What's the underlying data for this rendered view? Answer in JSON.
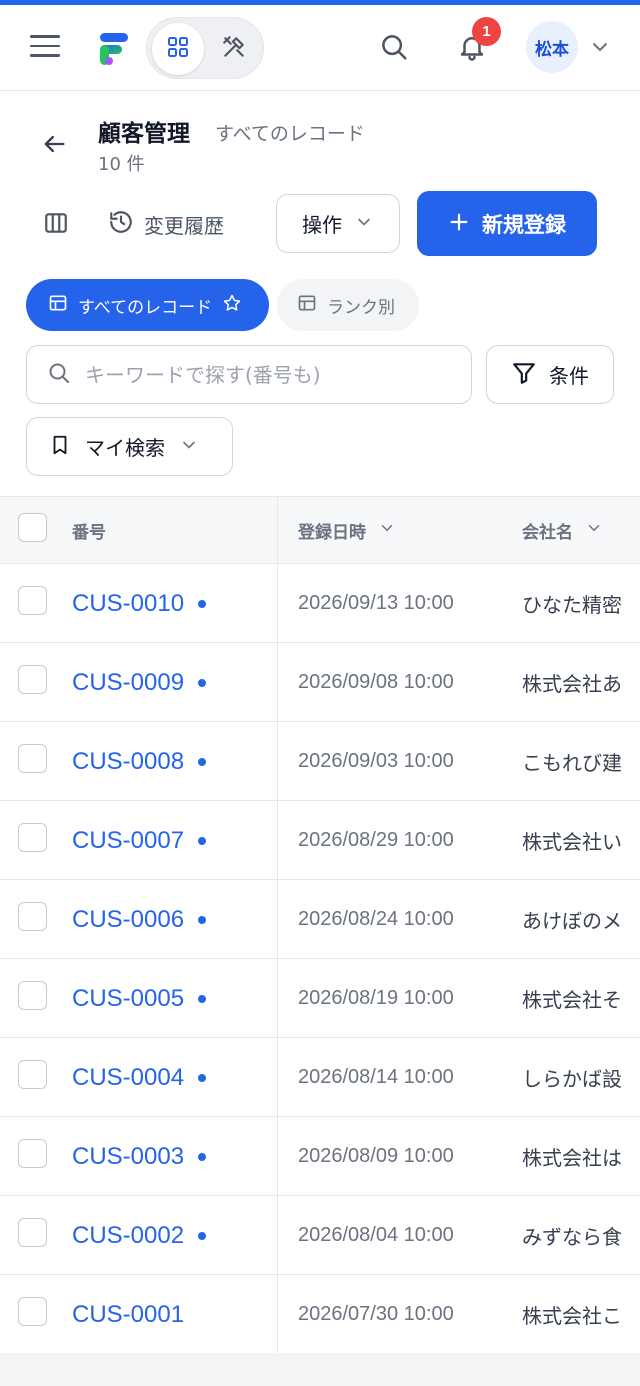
{
  "header": {
    "bell_badge": "1",
    "user_name": "松本",
    "icons": [
      "menu-icon",
      "app-logo",
      "grid-icon",
      "tools-icon",
      "search-icon",
      "bell-icon",
      "chevron-down-icon"
    ]
  },
  "page": {
    "title": "顧客管理",
    "subtitle": "すべてのレコード",
    "count": "10 件"
  },
  "toolbar": {
    "history_label": "変更履歴",
    "ops_label": "操作",
    "new_label": "新規登録"
  },
  "tabs": [
    {
      "label": "すべてのレコード",
      "active": true
    },
    {
      "label": "ランク別",
      "active": false
    }
  ],
  "search": {
    "placeholder": "キーワードで探す(番号も)",
    "value": "",
    "conditions_label": "条件",
    "my_search_label": "マイ検索"
  },
  "table": {
    "columns": [
      "番号",
      "登録日時",
      "会社名"
    ],
    "rows": [
      {
        "id": "CUS-0010",
        "date": "2026/09/13 10:00",
        "company": "ひなた精密"
      },
      {
        "id": "CUS-0009",
        "date": "2026/09/08 10:00",
        "company": "株式会社あ"
      },
      {
        "id": "CUS-0008",
        "date": "2026/09/03 10:00",
        "company": "こもれび建"
      },
      {
        "id": "CUS-0007",
        "date": "2026/08/29 10:00",
        "company": "株式会社い"
      },
      {
        "id": "CUS-0006",
        "date": "2026/08/24 10:00",
        "company": "あけぼのメ"
      },
      {
        "id": "CUS-0005",
        "date": "2026/08/19 10:00",
        "company": "株式会社そ"
      },
      {
        "id": "CUS-0004",
        "date": "2026/08/14 10:00",
        "company": "しらかば設"
      },
      {
        "id": "CUS-0003",
        "date": "2026/08/09 10:00",
        "company": "株式会社は"
      },
      {
        "id": "CUS-0002",
        "date": "2026/08/04 10:00",
        "company": "みずなら食"
      },
      {
        "id": "CUS-0001",
        "date": "2026/07/30 10:00",
        "company": "株式会社こ"
      }
    ],
    "unread_dot": [
      true,
      true,
      true,
      true,
      true,
      true,
      true,
      true,
      true,
      false
    ]
  },
  "colors": {
    "accent": "#2563eb",
    "badge": "#ef4444"
  }
}
